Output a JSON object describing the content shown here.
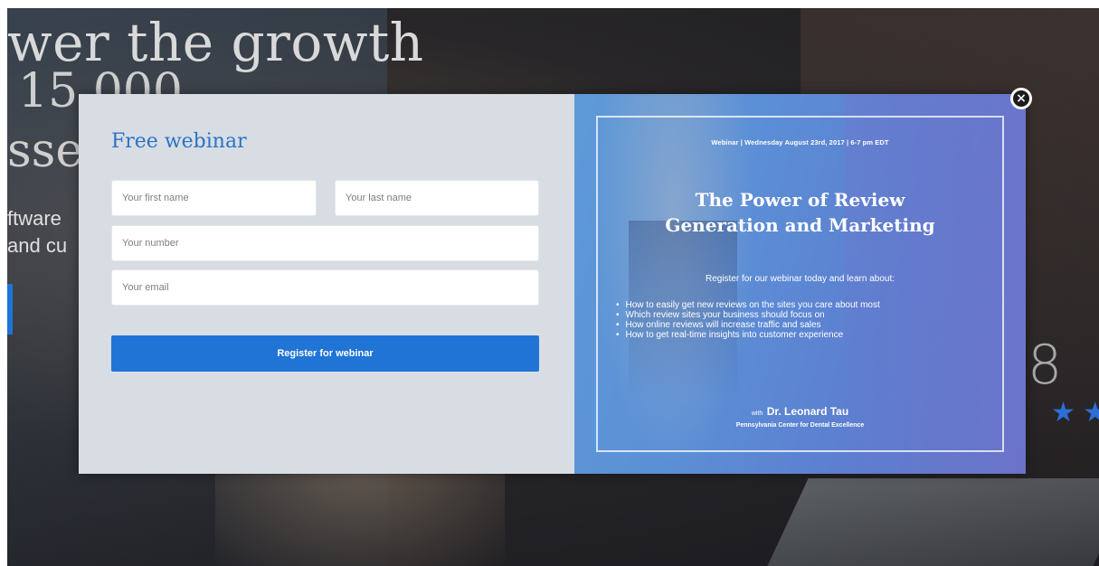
{
  "background": {
    "hero_line1": "wer the growth",
    "hero_line2": "15 000",
    "hero_line3": "sse",
    "hero_sub1": "ftware",
    "hero_sub2": "and cu",
    "rating_number": "8",
    "stars": "★ ★"
  },
  "modal": {
    "title": "Free webinar",
    "form": {
      "first_name_placeholder": "Your first name",
      "last_name_placeholder": "Your last name",
      "number_placeholder": "Your number",
      "email_placeholder": "Your email",
      "submit_label": "Register for webinar"
    },
    "promo": {
      "meta": "Webinar | Wednesday August 23rd, 2017 | 6-7 pm EDT",
      "title_line1": "The Power of Review",
      "title_line2": "Generation and Marketing",
      "intro": "Register for our webinar today and learn about:",
      "points": [
        "How to easily get new reviews on the sites you care about most",
        "Which review sites your business should focus on",
        "How online reviews will increase traffic and sales",
        "How to get real-time insights into customer experience"
      ],
      "host_prefix": "with",
      "host_name": "Dr. Leonard Tau",
      "host_org": "Pennsylvania Center for Dental Excellence"
    },
    "close_icon": "close-icon"
  },
  "colors": {
    "accent": "#1f74d6",
    "title_blue": "#2a73c8",
    "form_bg": "#d8dde3"
  }
}
